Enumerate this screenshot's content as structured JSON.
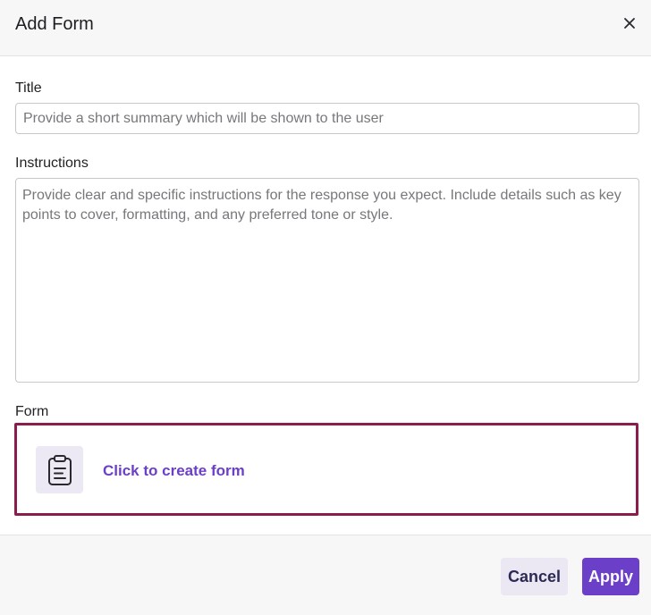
{
  "dialog": {
    "title": "Add Form",
    "close_icon": "close-icon"
  },
  "fields": {
    "title": {
      "label": "Title",
      "value": "",
      "placeholder": "Provide a short summary which will be shown to the user"
    },
    "instructions": {
      "label": "Instructions",
      "value": "",
      "placeholder": "Provide clear and specific instructions for the response you expect. Include details such as key points to cover, formatting, and any preferred tone or style."
    },
    "form": {
      "label": "Form",
      "icon": "clipboard-icon",
      "cta": "Click to create form"
    }
  },
  "footer": {
    "cancel_label": "Cancel",
    "apply_label": "Apply"
  },
  "colors": {
    "accent": "#6b3fc8",
    "focus_border": "#8b1d4c",
    "icon_bg": "#ece9f4",
    "cancel_bg": "#ebe8f3"
  }
}
